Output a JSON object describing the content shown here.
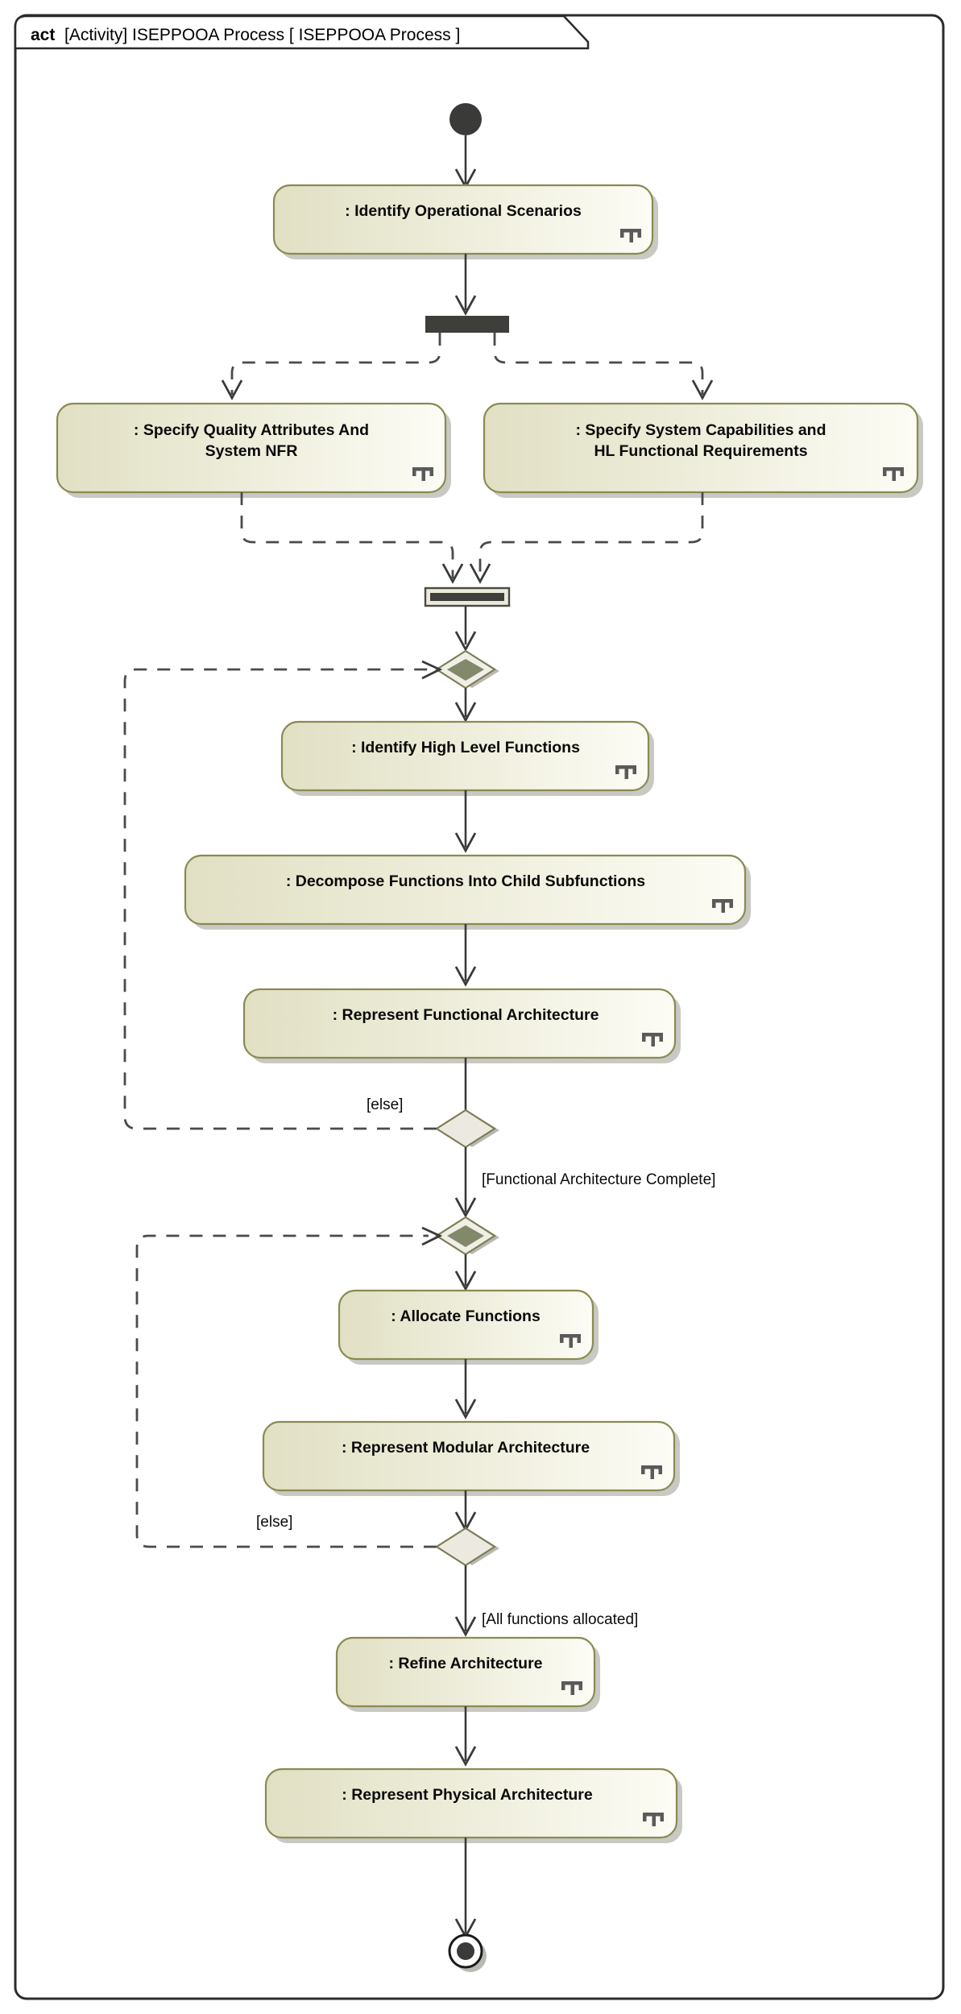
{
  "frame": {
    "keyword": "act",
    "title": "[Activity] ISEPPOOA Process [ ISEPPOOA Process ]",
    "type_label": "[Activity]",
    "name": "ISEPPOOA Process",
    "diagram_name": "[ ISEPPOOA Process ]"
  },
  "colors": {
    "node_border": "#8a8a52",
    "node_fill_left": "#e3e2c8",
    "node_fill_right": "#fbfbf3",
    "bar_fill": "#3e3e3b",
    "merge_inner": "#82886a",
    "decision_fill": "#eceae0",
    "edge": "#3a3a3a",
    "shadow": "#b4b4ac",
    "rake": "#5a5a5a",
    "frame_border": "#2b2b2b"
  },
  "nodes": {
    "initial": {
      "kind": "initial-node",
      "name": "initial-node"
    },
    "final": {
      "kind": "activity-final-node",
      "name": "activity-final-node"
    },
    "fork1": {
      "kind": "fork-bar",
      "name": "fork-node"
    },
    "join1": {
      "kind": "join-bar",
      "name": "join-node"
    },
    "merge1": {
      "kind": "merge-node",
      "name": "merge-node-functional-loop"
    },
    "merge2": {
      "kind": "merge-node",
      "name": "merge-node-allocation-loop"
    },
    "decision1": {
      "kind": "decision-node",
      "name": "decision-node-functional-complete"
    },
    "decision2": {
      "kind": "decision-node",
      "name": "decision-node-all-allocated"
    }
  },
  "actions": [
    {
      "id": "identify-operational-scenarios",
      "label": ": Identify Operational Scenarios",
      "lines": [
        ": Identify Operational Scenarios"
      ],
      "rake": true
    },
    {
      "id": "specify-quality-attributes",
      "label": ": Specify Quality Attributes And System NFR",
      "lines": [
        ": Specify Quality Attributes And",
        "System NFR"
      ],
      "rake": true
    },
    {
      "id": "specify-system-capabilities",
      "label": ": Specify System Capabilities and HL Functional Requirements",
      "lines": [
        ": Specify System Capabilities and",
        "HL Functional Requirements"
      ],
      "rake": true
    },
    {
      "id": "identify-high-level-functions",
      "label": ": Identify High Level Functions",
      "lines": [
        ": Identify High Level Functions"
      ],
      "rake": true
    },
    {
      "id": "decompose-functions",
      "label": ": Decompose Functions Into Child Subfunctions",
      "lines": [
        ": Decompose Functions Into Child Subfunctions"
      ],
      "rake": true
    },
    {
      "id": "represent-functional-architecture",
      "label": ": Represent Functional Architecture",
      "lines": [
        ": Represent Functional Architecture"
      ],
      "rake": true
    },
    {
      "id": "allocate-functions",
      "label": ": Allocate Functions",
      "lines": [
        ": Allocate Functions"
      ],
      "rake": true
    },
    {
      "id": "represent-modular-architecture",
      "label": ": Represent Modular Architecture",
      "lines": [
        ": Represent Modular Architecture"
      ],
      "rake": true
    },
    {
      "id": "refine-architecture",
      "label": ": Refine Architecture",
      "lines": [
        ": Refine Architecture"
      ],
      "rake": true
    },
    {
      "id": "represent-physical-architecture",
      "label": ": Represent Physical Architecture",
      "lines": [
        ": Represent Physical Architecture"
      ],
      "rake": true
    }
  ],
  "guards": [
    {
      "id": "guard-else-functional",
      "text": "[else]"
    },
    {
      "id": "guard-functional-complete",
      "text": "[Functional Architecture Complete]"
    },
    {
      "id": "guard-else-allocation",
      "text": "[else]"
    },
    {
      "id": "guard-all-allocated",
      "text": "[All functions allocated]"
    }
  ]
}
